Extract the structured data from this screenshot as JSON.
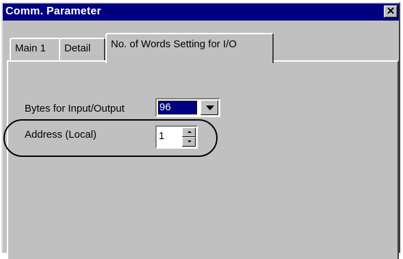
{
  "window": {
    "title": "Comm. Parameter",
    "close_symbol": "✕",
    "colors": {
      "titlebar": "#000080",
      "face": "#c0c0c0",
      "selection": "#000080"
    }
  },
  "tabs": [
    {
      "label": "Main 1",
      "selected": false
    },
    {
      "label": "Detail",
      "selected": false
    },
    {
      "label": "No. of Words Setting for I/O",
      "selected": true
    }
  ],
  "form": {
    "bytes_label": "Bytes for Input/Output",
    "bytes_value": "96",
    "address_label": "Address (Local)",
    "address_value": "1"
  },
  "icons": {
    "close": "close-icon",
    "dropdown": "chevron-down-icon",
    "spin_up": "spin-up-icon",
    "spin_down": "spin-down-icon"
  }
}
